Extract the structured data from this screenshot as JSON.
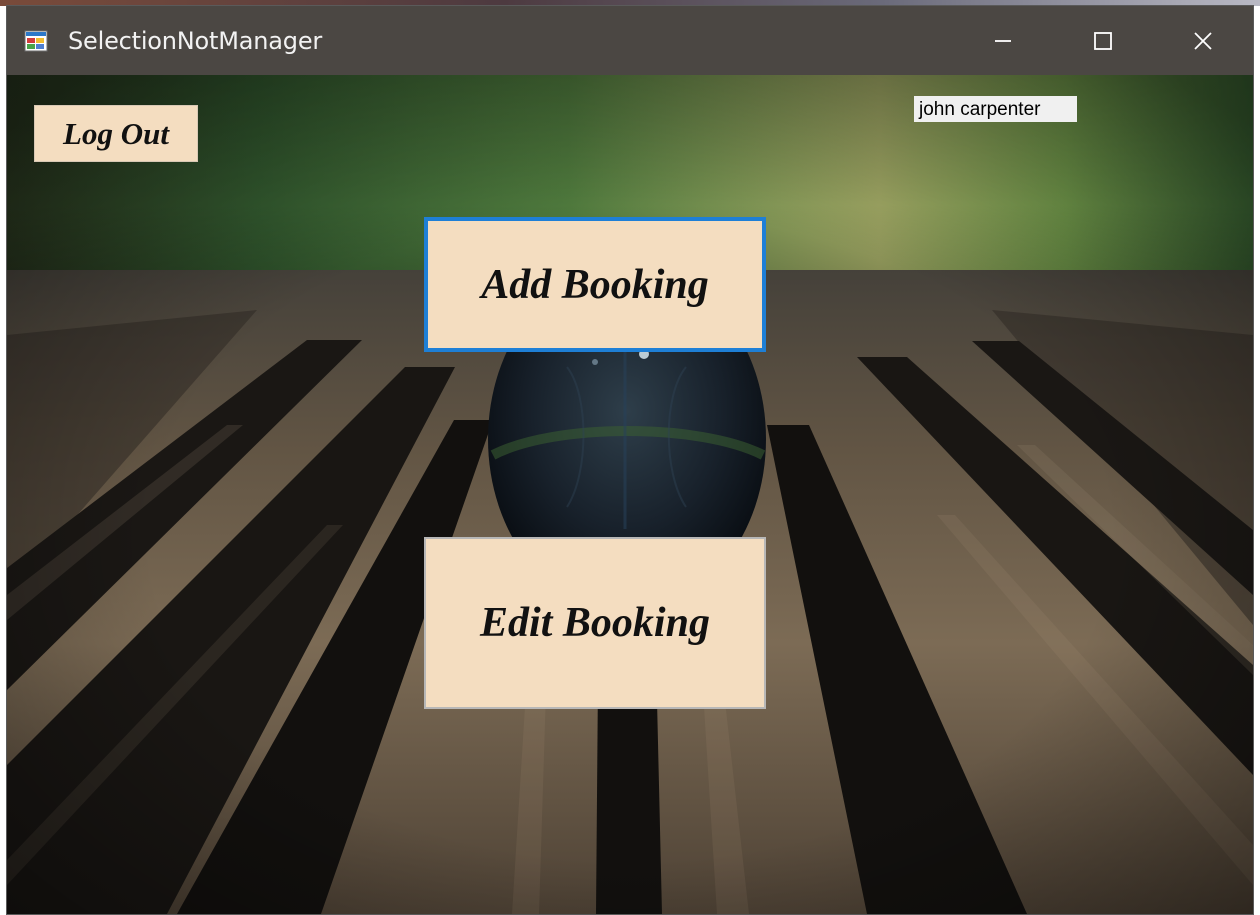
{
  "window": {
    "title": "SelectionNotManager",
    "controls": {
      "minimize_icon": "minimize-icon",
      "maximize_icon": "maximize-icon",
      "close_icon": "close-icon"
    }
  },
  "header": {
    "logout_label": "Log Out",
    "current_user": "john carpenter"
  },
  "main": {
    "add_booking_label": "Add Booking",
    "edit_booking_label": "Edit Booking"
  },
  "colors": {
    "button_fill": "#f4ddc0",
    "focus_border": "#1e7fd6",
    "titlebar": "#4b4743"
  }
}
